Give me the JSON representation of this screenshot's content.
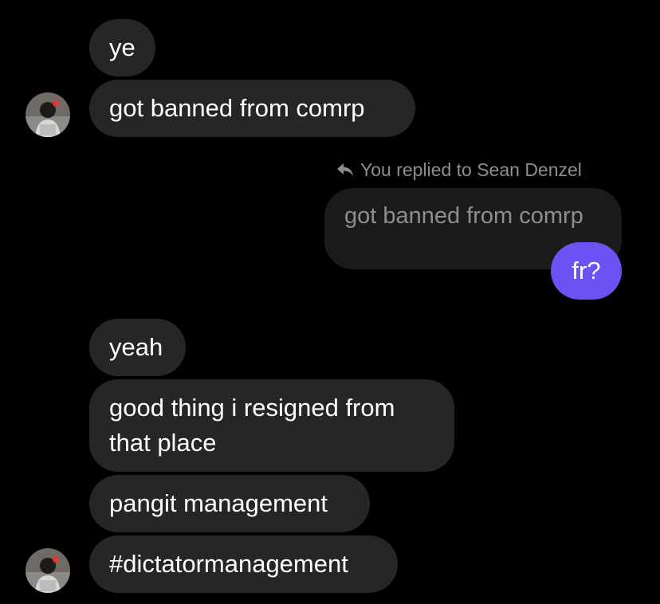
{
  "thread": {
    "group1": [
      "ye",
      "got banned from comrp"
    ],
    "reply": {
      "label": "You replied to Sean Denzel",
      "quoted_text": "got banned from comrp",
      "message": "fr?"
    },
    "group2": [
      "yeah",
      "good thing i resigned from",
      "that place",
      "pangit management",
      "#dictatormanagement"
    ]
  },
  "colors": {
    "background": "#000000",
    "incoming_bubble": "#262626",
    "quoted_bubble": "#1a1a1a",
    "outgoing_bubble": "#6a52f5",
    "meta_text": "#8e8e8e"
  },
  "icons": {
    "reply": "reply-arrow-icon",
    "avatar": "avatar"
  }
}
